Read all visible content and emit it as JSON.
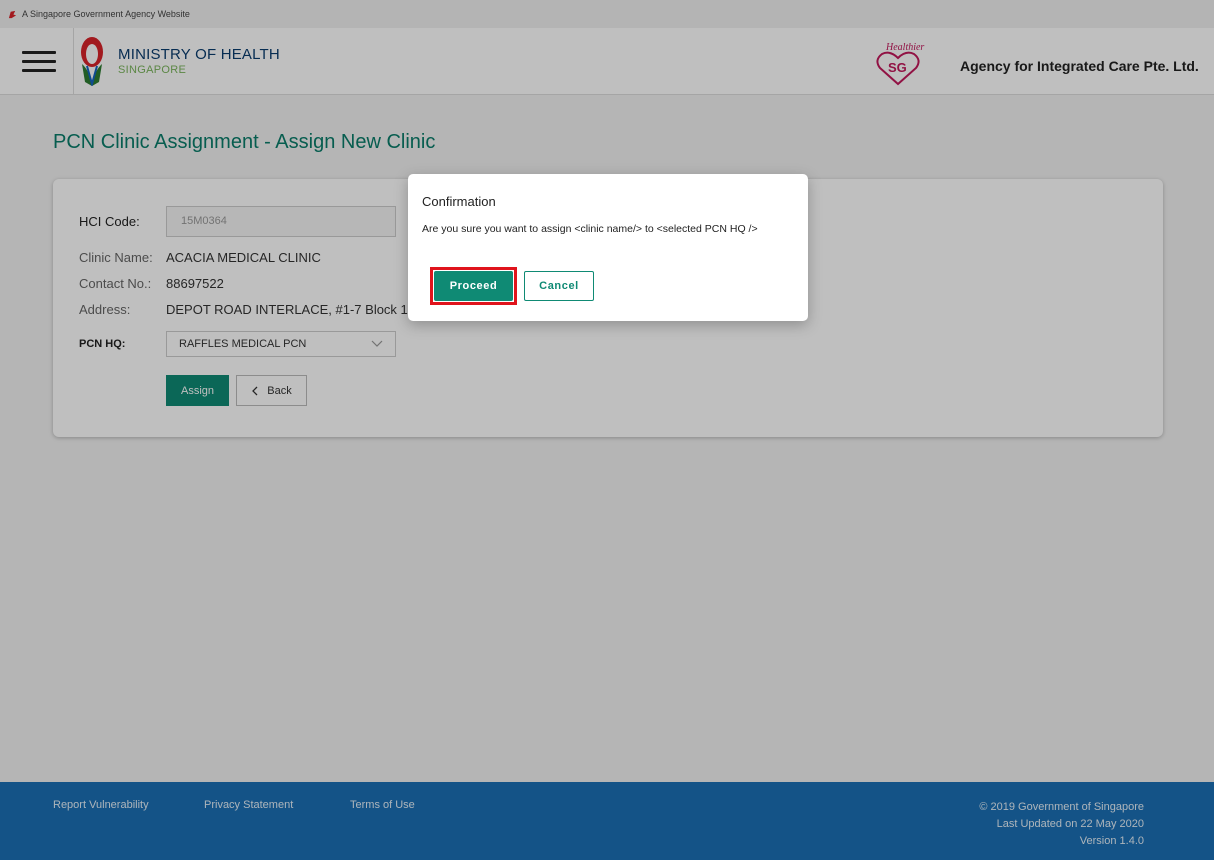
{
  "gov_bar": {
    "text": "A Singapore Government Agency Website",
    "icon": "lion-head-icon"
  },
  "header": {
    "moh_title": "MINISTRY OF HEALTH",
    "moh_subtitle": "SINGAPORE",
    "healthier_sg_logo_text": "Healthier SG",
    "agency": "Agency for Integrated Care Pte. Ltd."
  },
  "page": {
    "title": "PCN Clinic Assignment - Assign New Clinic"
  },
  "form": {
    "hci_code_label": "HCI Code:",
    "hci_code_value": "15M0364",
    "clinic_name_label": "Clinic Name:",
    "clinic_name_value": "ACACIA MEDICAL CLINIC",
    "contact_label": "Contact No.:",
    "contact_value": "88697522",
    "address_label": "Address:",
    "address_value": "DEPOT ROAD INTERLACE, #1-7 Block 18",
    "pcn_hq_label": "PCN HQ:",
    "pcn_hq_value": "RAFFLES MEDICAL PCN",
    "assign_label": "Assign",
    "back_label": "Back"
  },
  "modal": {
    "title": "Confirmation",
    "message": "Are you sure you want to assign <clinic name/> to <selected PCN HQ />",
    "proceed_label": "Proceed",
    "cancel_label": "Cancel"
  },
  "footer": {
    "links": [
      "Report Vulnerability",
      "Privacy Statement",
      "Terms of Use"
    ],
    "copyright": "© 2019 Government of Singapore",
    "last_updated": "Last Updated on 22 May 2020",
    "version": "Version 1.4.0"
  },
  "colors": {
    "primary_teal": "#0f8a74",
    "footer_blue": "#1b6fb4",
    "highlight_red": "#e0141c"
  }
}
